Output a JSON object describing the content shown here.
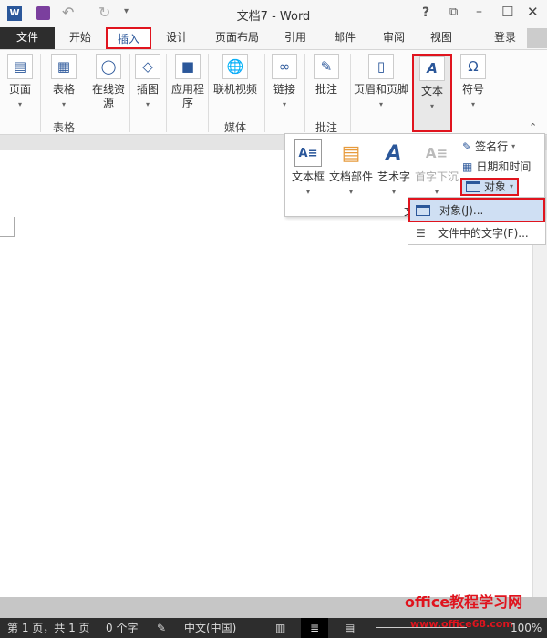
{
  "window": {
    "title": "文档7 - Word",
    "help": "?",
    "restore": "⧉",
    "minimize": "–",
    "maximize": "☐",
    "close": "✕"
  },
  "quick_access": {
    "word_icon": "W",
    "save_icon": "save-icon",
    "undo": "↶",
    "redo": "↻",
    "customize": "▾"
  },
  "tabs": [
    {
      "label": "文件"
    },
    {
      "label": "开始"
    },
    {
      "label": "插入"
    },
    {
      "label": "设计"
    },
    {
      "label": "页面布局"
    },
    {
      "label": "引用"
    },
    {
      "label": "邮件"
    },
    {
      "label": "审阅"
    },
    {
      "label": "视图"
    }
  ],
  "signin": "登录",
  "ribbon": {
    "buttons": [
      {
        "label": "页面",
        "icon": "▤"
      },
      {
        "label": "表格",
        "icon": "▦"
      },
      {
        "label": "在线资源",
        "icon": "◯"
      },
      {
        "label": "插图",
        "icon": "◇"
      },
      {
        "label": "应用程序",
        "icon": "■"
      },
      {
        "label": "联机视频",
        "icon": "🌐"
      },
      {
        "label": "链接",
        "icon": "∞"
      },
      {
        "label": "批注",
        "icon": "✎"
      },
      {
        "label": "页眉和页脚",
        "icon": "▯"
      },
      {
        "label": "文本",
        "icon": "A"
      },
      {
        "label": "符号",
        "icon": "Ω"
      }
    ],
    "groups": {
      "table": "表格",
      "media": "媒体",
      "comments": "批注"
    },
    "collapse": "⌃"
  },
  "text_panel": {
    "buttons": [
      {
        "label": "文本框",
        "icon": "A≡"
      },
      {
        "label": "文档部件",
        "icon": "▤"
      },
      {
        "label": "艺术字",
        "icon": "A"
      },
      {
        "label": "首字下沉",
        "icon": "A≡"
      }
    ],
    "signature": "签名行",
    "datetime": "日期和时间",
    "object": "对象",
    "group_label": "文"
  },
  "submenu": {
    "items": [
      {
        "label": "对象(J)..."
      },
      {
        "label": "文件中的文字(F)..."
      }
    ]
  },
  "status": {
    "page": "第 1 页，共 1 页",
    "words": "0 个字",
    "language": "中文(中国)",
    "zoom": "100%"
  },
  "watermark": {
    "site": "office教程学习网",
    "url": "www.office68.com"
  },
  "colors": {
    "accent": "#2b579a",
    "highlight": "#e0141e",
    "file_tab": "#2d2d2d"
  }
}
